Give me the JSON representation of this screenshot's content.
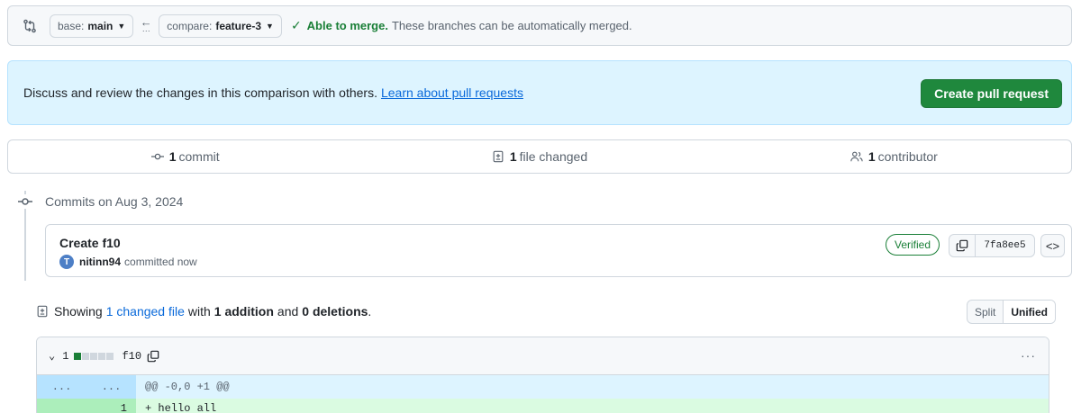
{
  "range": {
    "base_label": "base:",
    "base_value": "main",
    "compare_label": "compare:",
    "compare_value": "feature-3",
    "merge_ok": "Able to merge.",
    "merge_detail": "These branches can be automatically merged."
  },
  "flash": {
    "message": "Discuss and review the changes in this comparison with others.",
    "link": "Learn about pull requests",
    "button": "Create pull request"
  },
  "summary": {
    "commits_count": "1",
    "commits_label": "commit",
    "files_count": "1",
    "files_label": "file changed",
    "contributors_count": "1",
    "contributors_label": "contributor"
  },
  "timeline": {
    "title": "Commits on Aug 3, 2024",
    "commit": {
      "title": "Create f10",
      "author": "nitinn94",
      "time": "committed now",
      "verified": "Verified",
      "sha": "7fa8ee5"
    }
  },
  "diff_summary": {
    "showing": "Showing",
    "changed_file_link": "1 changed file",
    "with": "with",
    "additions": "1 addition",
    "and": "and",
    "deletions": "0 deletions",
    "period": "."
  },
  "view_toggle": {
    "split": "Split",
    "unified": "Unified"
  },
  "file": {
    "change_count": "1",
    "name": "f10",
    "more": "···",
    "hunk_left": "...",
    "hunk_right": "...",
    "hunk_header": "@@ -0,0 +1 @@",
    "lines": [
      {
        "new_num": "1",
        "text": "+ hello all"
      }
    ]
  },
  "colors": {
    "merge_green": "#1a7f37",
    "create_button": "#1f883d",
    "link_blue": "#0969da",
    "flash_bg": "#ddf4ff"
  },
  "icons": [
    "git-compare-icon",
    "arrow-left-icon",
    "check-icon",
    "commit-icon",
    "file-diff-icon",
    "people-icon",
    "copy-icon",
    "code-icon",
    "chevron-down-icon",
    "kebab-icon"
  ]
}
